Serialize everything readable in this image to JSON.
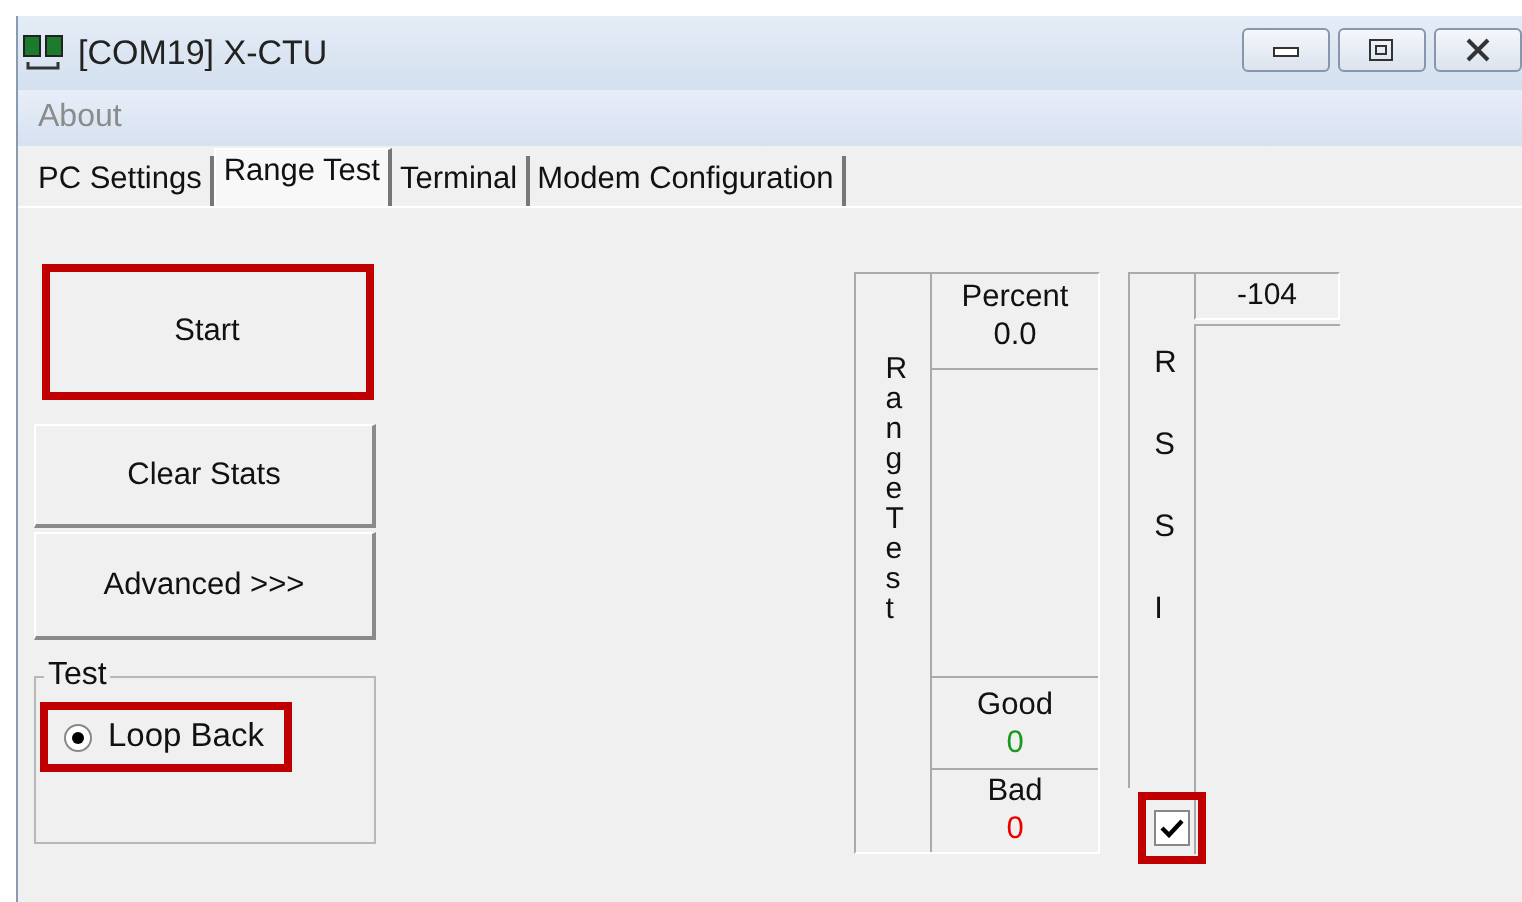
{
  "window": {
    "title": "[COM19] X-CTU"
  },
  "menu": [
    {
      "label": "About",
      "disabled": true
    }
  ],
  "tabs": [
    {
      "label": "PC Settings",
      "selected": false
    },
    {
      "label": "Range Test",
      "selected": true
    },
    {
      "label": "Terminal",
      "selected": false
    },
    {
      "label": "Modem Configuration",
      "selected": false
    }
  ],
  "buttons": [
    {
      "label": "Start",
      "highlighted": true
    },
    {
      "label": "Clear Stats",
      "highlighted": false
    },
    {
      "label": "Advanced >>>",
      "highlighted": false
    }
  ],
  "test_group": {
    "title": "Test",
    "options": [
      {
        "label": "Loop Back",
        "selected": true,
        "highlighted": true
      }
    ]
  },
  "range_test": {
    "title": "Range Test",
    "percent_label": "Percent",
    "percent": "0.0",
    "good_label": "Good",
    "good": "0",
    "bad_label": "Bad",
    "bad": "0"
  },
  "rssi": {
    "title": "RSSI",
    "reading": "-104",
    "enabled": {
      "checked": true,
      "highlighted": true
    }
  }
}
